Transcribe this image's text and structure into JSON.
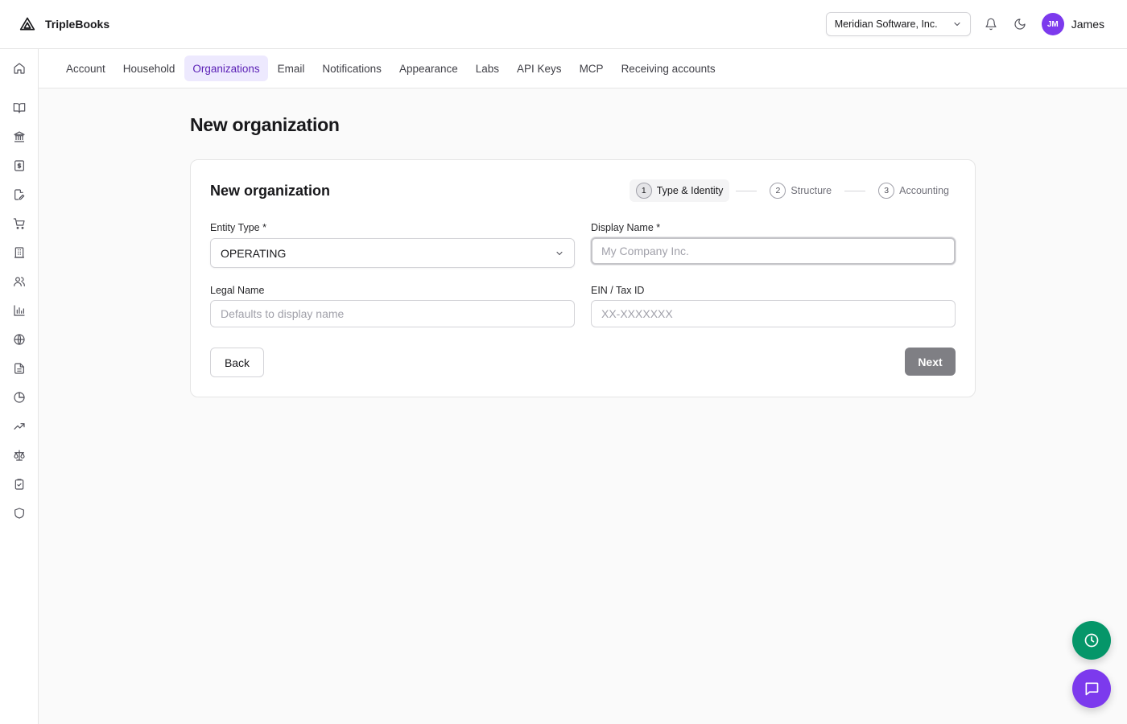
{
  "app": {
    "name": "TripleBooks",
    "org_selector": "Meridian Software, Inc.",
    "user": {
      "initials": "JM",
      "name": "James"
    }
  },
  "sidebar": {
    "items": [
      {
        "name": "home-icon"
      },
      {
        "name": "book-open-icon"
      },
      {
        "name": "bank-icon"
      },
      {
        "name": "dollar-receipt-icon"
      },
      {
        "name": "file-edit-icon"
      },
      {
        "name": "shopping-cart-icon"
      },
      {
        "name": "building-icon"
      },
      {
        "name": "users-icon"
      },
      {
        "name": "bar-chart-icon"
      },
      {
        "name": "globe-icon"
      },
      {
        "name": "document-icon"
      },
      {
        "name": "pie-chart-icon"
      },
      {
        "name": "trending-up-icon"
      },
      {
        "name": "scale-icon"
      },
      {
        "name": "clipboard-check-icon"
      },
      {
        "name": "shield-icon"
      }
    ]
  },
  "settings_tabs": [
    {
      "label": "Account"
    },
    {
      "label": "Household"
    },
    {
      "label": "Organizations",
      "active": true
    },
    {
      "label": "Email"
    },
    {
      "label": "Notifications"
    },
    {
      "label": "Appearance"
    },
    {
      "label": "Labs"
    },
    {
      "label": "API Keys"
    },
    {
      "label": "MCP"
    },
    {
      "label": "Receiving accounts"
    }
  ],
  "page": {
    "title": "New organization",
    "card_title": "New organization"
  },
  "stepper": [
    {
      "num": "1",
      "label": "Type & Identity",
      "active": true
    },
    {
      "num": "2",
      "label": "Structure"
    },
    {
      "num": "3",
      "label": "Accounting"
    }
  ],
  "form": {
    "entity_type": {
      "label": "Entity Type *",
      "value": "OPERATING"
    },
    "display_name": {
      "label": "Display Name *",
      "value": "",
      "placeholder": "My Company Inc."
    },
    "legal_name": {
      "label": "Legal Name",
      "value": "",
      "placeholder": "Defaults to display name"
    },
    "ein": {
      "label": "EIN / Tax ID",
      "value": "",
      "placeholder": "XX-XXXXXXX"
    }
  },
  "buttons": {
    "back": "Back",
    "next": "Next"
  },
  "fabs": [
    {
      "name": "clock-icon"
    },
    {
      "name": "chat-icon"
    }
  ],
  "colors": {
    "accent": "#7c3aed",
    "active_tab_bg": "#ede9fe",
    "active_tab_text": "#5b21b6",
    "next_button_disabled": "#7f7f84",
    "fab_green": "#059669",
    "fab_purple": "#7c3aed"
  }
}
